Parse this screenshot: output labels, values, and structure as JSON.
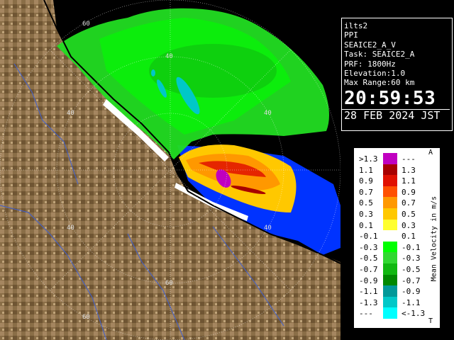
{
  "map": {
    "ring_labels": [
      "60",
      "40",
      "40",
      "40",
      "40",
      "60",
      "40",
      "60"
    ]
  },
  "info": {
    "station": "ilts2",
    "product": "PPI",
    "scan": "SEAICE2_A_V",
    "task": "Task: SEAICE2_A",
    "prf": "PRF: 1800Hz",
    "elevation": "Elevation:1.0",
    "max_range": "Max Range:60 km",
    "time": "20:59:53",
    "date": "28 FEB 2024 JST"
  },
  "legend": {
    "unit": "Mean Velocity in m/s",
    "top_mark": "A",
    "bottom_mark": "T",
    "rows": [
      {
        "lo": ">1.3",
        "hi": "---",
        "color": "#c000c0"
      },
      {
        "lo": "1.1",
        "hi": "1.3",
        "color": "#a80000"
      },
      {
        "lo": "0.9",
        "hi": "1.1",
        "color": "#e01000"
      },
      {
        "lo": "0.7",
        "hi": "0.9",
        "color": "#ff5000"
      },
      {
        "lo": "0.5",
        "hi": "0.7",
        "color": "#ff9800"
      },
      {
        "lo": "0.3",
        "hi": "0.5",
        "color": "#ffc800"
      },
      {
        "lo": "0.1",
        "hi": "0.3",
        "color": "#ffff30"
      },
      {
        "lo": "-0.1",
        "hi": "0.1",
        "color": "#ffffff"
      },
      {
        "lo": "-0.3",
        "hi": "-0.1",
        "color": "#00ff00"
      },
      {
        "lo": "-0.5",
        "hi": "-0.3",
        "color": "#30d830"
      },
      {
        "lo": "-0.7",
        "hi": "-0.5",
        "color": "#10b810"
      },
      {
        "lo": "-0.9",
        "hi": "-0.7",
        "color": "#008800"
      },
      {
        "lo": "-1.1",
        "hi": "-0.9",
        "color": "#009898"
      },
      {
        "lo": "-1.3",
        "hi": "-1.1",
        "color": "#00c8c8"
      },
      {
        "lo": "---",
        "hi": "<-1.3",
        "color": "#00ffff"
      }
    ]
  }
}
